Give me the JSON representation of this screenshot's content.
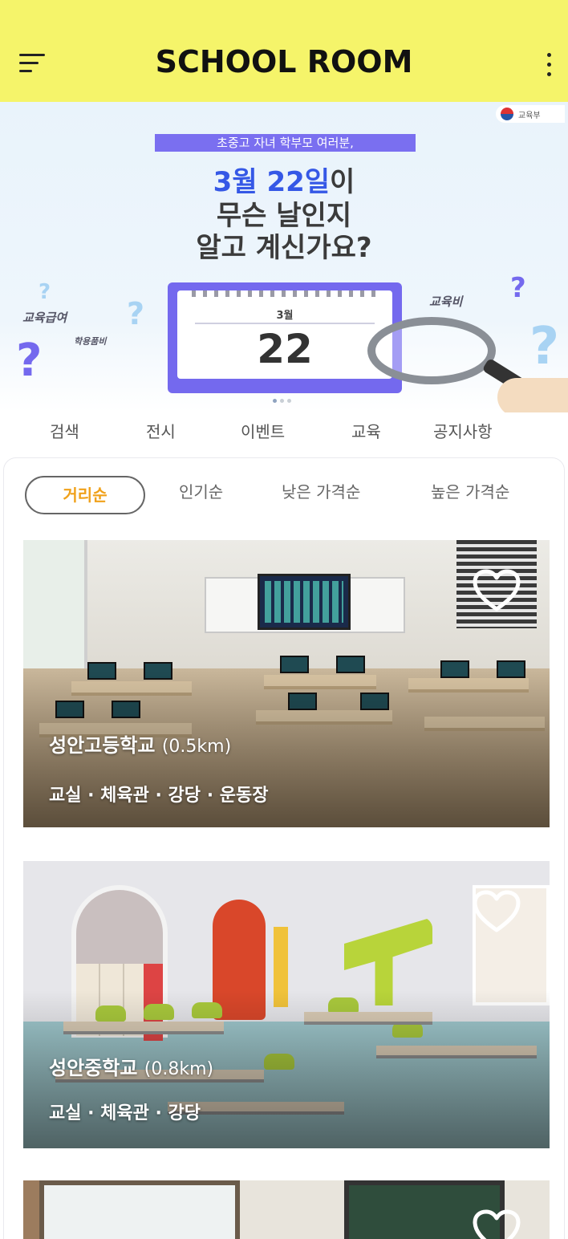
{
  "app": {
    "title": "SCHOOL ROOM"
  },
  "banner": {
    "pill": "초중고 자녀 학부모 여러분,",
    "line1_blue": "3월 22일",
    "line1_rest": "이",
    "line2": "무슨 날인지",
    "line3": "알고 계신가요?",
    "calendar_month": "3월",
    "calendar_day": "22",
    "tag_left": "교육급여",
    "tag_left_sub": "학용품비",
    "tag_right": "교육비",
    "gov_logo_text": "교육부",
    "colors": {
      "accent": "#3558e6",
      "calendar": "#7469ee"
    }
  },
  "categories": [
    {
      "label": "검색"
    },
    {
      "label": "전시"
    },
    {
      "label": "이벤트"
    },
    {
      "label": "교육"
    },
    {
      "label": "공지사항"
    }
  ],
  "sort": {
    "options": [
      {
        "label": "거리순",
        "active": true
      },
      {
        "label": "인기순",
        "active": false
      },
      {
        "label": "낮은 가격순",
        "active": false
      },
      {
        "label": "높은 가격순",
        "active": false
      }
    ],
    "active_color": "#f0a11a"
  },
  "schools": [
    {
      "name": "성안고등학교",
      "distance": "(0.5km)",
      "facilities": "교실 · 체육관 · 강당 · 운동장",
      "favorite": false,
      "icon": "heart-outline-icon"
    },
    {
      "name": "성안중학교",
      "distance": "(0.8km)",
      "facilities": "교실 · 체육관 · 강당",
      "favorite": false,
      "icon": "heart-outline-icon"
    },
    {
      "name": "",
      "distance": "",
      "facilities": "",
      "favorite": false,
      "icon": "heart-outline-icon"
    }
  ],
  "theme": {
    "header_bg": "#f5f46a"
  }
}
